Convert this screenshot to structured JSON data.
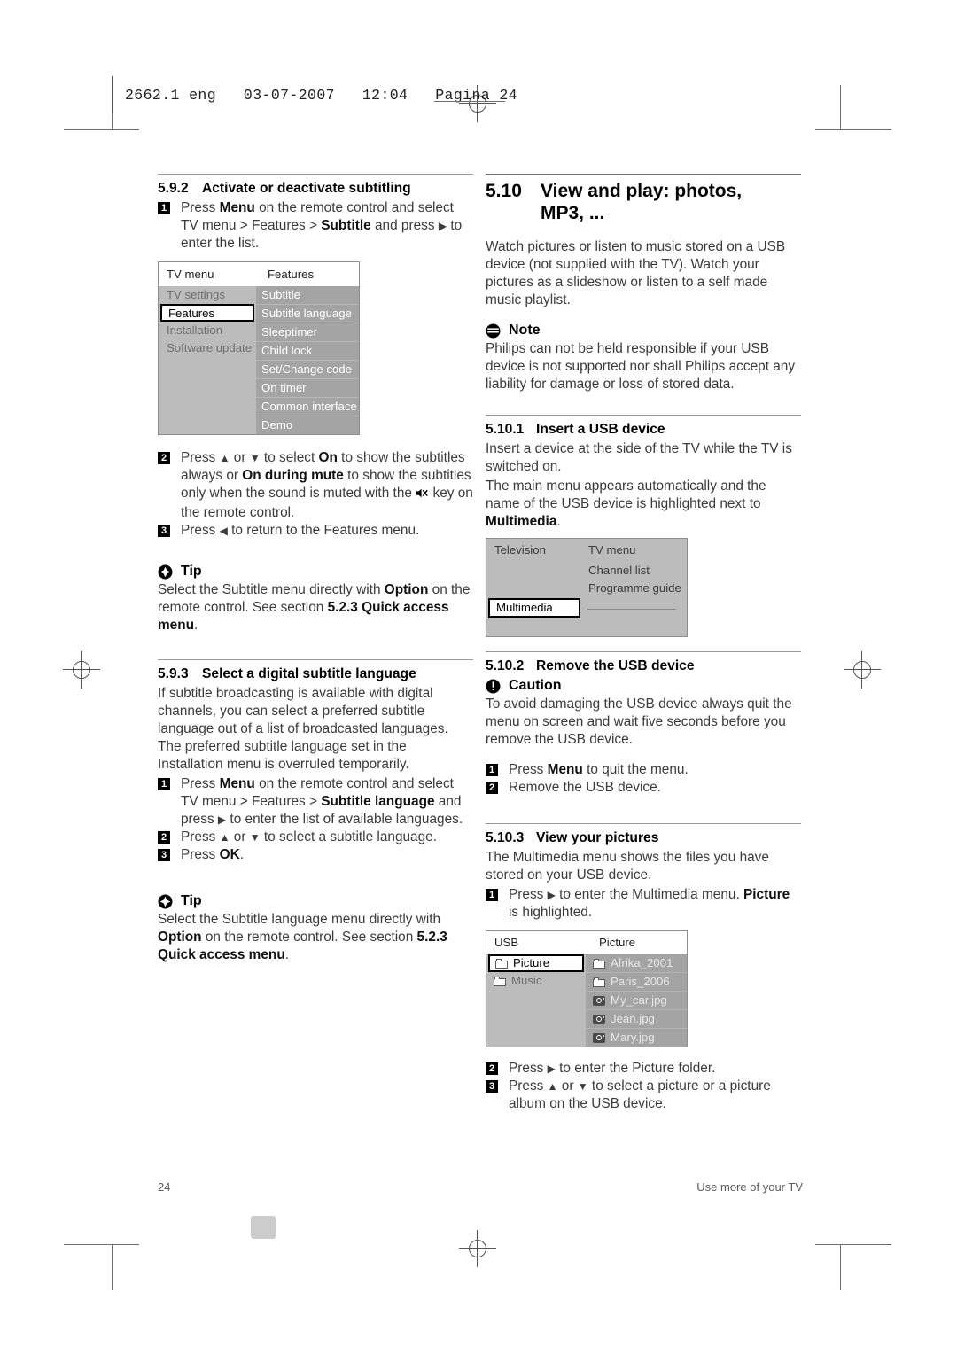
{
  "page_header": "2662.1 eng   03-07-2007   12:04   Pagina 24",
  "footer": {
    "page_number": "24",
    "running_title": "Use more of your TV"
  },
  "left_column": {
    "section_592": {
      "number": "5.9.2",
      "title": "Activate or deactivate subtitling",
      "steps": [
        {
          "n": "1",
          "parts": [
            "Press ",
            "Menu",
            " on the remote control and select TV menu > Features > ",
            "Subtitle",
            " and press ▶ to enter the list."
          ]
        }
      ]
    },
    "osd_features": {
      "header_left": "TV menu",
      "header_right": "Features",
      "left_items": [
        "TV settings",
        "Features",
        "Installation",
        "Software update",
        "",
        "",
        "",
        ""
      ],
      "left_selected_index": 1,
      "right_items": [
        "Subtitle",
        "Subtitle language",
        "Sleeptimer",
        "Child lock",
        "Set/Change code",
        "On timer",
        "Common interface",
        "Demo"
      ]
    },
    "steps_after_osd": [
      {
        "n": "2",
        "text": "Press ▲ or ▼ to select On to show the subtitles always or On during mute to show the subtitles only when the sound is muted with the 🔇 key on the remote control."
      },
      {
        "n": "3",
        "text": "Press ◀ to return to the Features menu."
      }
    ],
    "tip1": {
      "icon": "tip-icon",
      "label": "Tip",
      "text": "Select the Subtitle menu directly with Option on the remote control. See section 5.2.3 Quick access menu."
    },
    "section_593": {
      "number": "5.9.3",
      "title": "Select a digital subtitle language",
      "intro": "If subtitle broadcasting is available with digital channels, you can select a preferred subtitle language out of a list of broadcasted languages. The preferred subtitle language set in the Installation menu is overruled temporarily.",
      "steps": [
        {
          "n": "1",
          "text": "Press Menu on the remote control and select TV menu > Features > Subtitle language and press ▶ to enter the list of available languages."
        },
        {
          "n": "2",
          "text": "Press ▲ or ▼ to select a subtitle language."
        },
        {
          "n": "3",
          "text": "Press OK."
        }
      ]
    },
    "tip2": {
      "icon": "tip-icon",
      "label": "Tip",
      "text": "Select the Subtitle language menu directly with Option on the remote control. See section 5.2.3 Quick access menu."
    }
  },
  "right_column": {
    "section_510": {
      "number": "5.10",
      "title_line1": "View and play: photos,",
      "title_line2": "MP3, ...",
      "intro": "Watch pictures or listen to music stored on a USB device (not supplied with the TV). Watch your pictures as a slideshow or listen to a self made music playlist."
    },
    "note": {
      "icon": "note-icon",
      "label": "Note",
      "text": "Philips can not be held responsible if your USB device is not supported nor shall Philips accept any liability for damage or loss of stored data."
    },
    "section_5101": {
      "number": "5.10.1",
      "title": "Insert a USB device",
      "paragraphs": [
        "Insert a device at the side of the TV while the TV is switched on.",
        "The main menu appears automatically and the name of the USB device is highlighted next to Multimedia."
      ]
    },
    "osd_mainmenu": {
      "left_label": "Television",
      "right_items": [
        "TV menu",
        "Channel list",
        "Programme guide"
      ],
      "selected_label": "Multimedia"
    },
    "section_5102": {
      "number": "5.10.2",
      "title": "Remove the USB device",
      "caution": {
        "icon": "caution-icon",
        "label": "Caution",
        "text": "To avoid damaging the USB device always quit the menu on screen and wait five seconds before you remove the USB device."
      },
      "steps": [
        {
          "n": "1",
          "text": "Press Menu to quit the menu."
        },
        {
          "n": "2",
          "text": "Remove the USB device."
        }
      ]
    },
    "section_5103": {
      "number": "5.10.3",
      "title": "View your pictures",
      "intro": "The Multimedia menu shows the files you have stored on your USB device.",
      "step1": {
        "n": "1",
        "text": "Press ▶ to enter the Multimedia menu. Picture is highlighted."
      },
      "osd_browser": {
        "header_left": "USB",
        "header_right": "Picture",
        "left_items": [
          {
            "label": "Picture",
            "icon": "folder-icon",
            "selected": true
          },
          {
            "label": "Music",
            "icon": "folder-icon",
            "selected": false
          }
        ],
        "right_items": [
          {
            "label": "Afrika_2001",
            "icon": "folder-icon"
          },
          {
            "label": "Paris_2006",
            "icon": "folder-icon"
          },
          {
            "label": "My_car.jpg",
            "icon": "camera-icon"
          },
          {
            "label": "Jean.jpg",
            "icon": "camera-icon"
          },
          {
            "label": "Mary.jpg",
            "icon": "camera-icon"
          }
        ]
      },
      "steps": [
        {
          "n": "2",
          "text": "Press ▶ to enter the Picture folder."
        },
        {
          "n": "3",
          "text": "Press ▲ or ▼ to select a picture or a picture album on the USB device."
        }
      ]
    }
  },
  "colors": {
    "osd_left_bg": "#bcbcbc",
    "osd_right_bg": "#a4a4a4",
    "text": "#3b3b3b"
  }
}
